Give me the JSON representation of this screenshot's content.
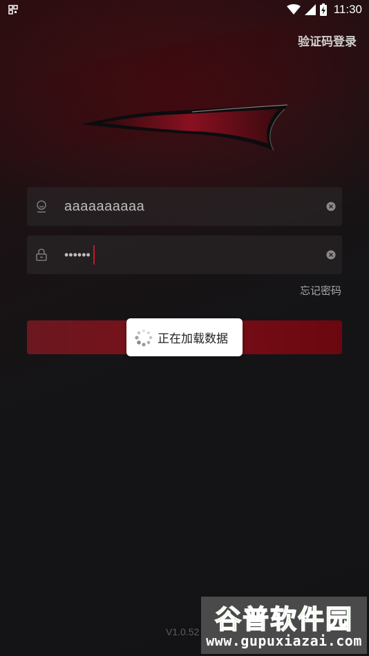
{
  "status_bar": {
    "time": "11:30",
    "icons": [
      "qr-icon",
      "wifi-icon",
      "signal-icon",
      "battery-icon"
    ]
  },
  "header": {
    "sms_login_link": "验证码登录"
  },
  "login_form": {
    "username_value": "aaaaaaaaaa",
    "password_value": "••••••",
    "forgot_password": "忘记密码"
  },
  "loading_toast": {
    "text": "正在加载数据"
  },
  "footer": {
    "version": "V1.0.52"
  },
  "watermark": {
    "title": "谷普软件园",
    "url": "www.gupuxiazai.com"
  },
  "colors": {
    "accent": "#c8162a",
    "button": "#7a1018",
    "background": "#141416"
  }
}
